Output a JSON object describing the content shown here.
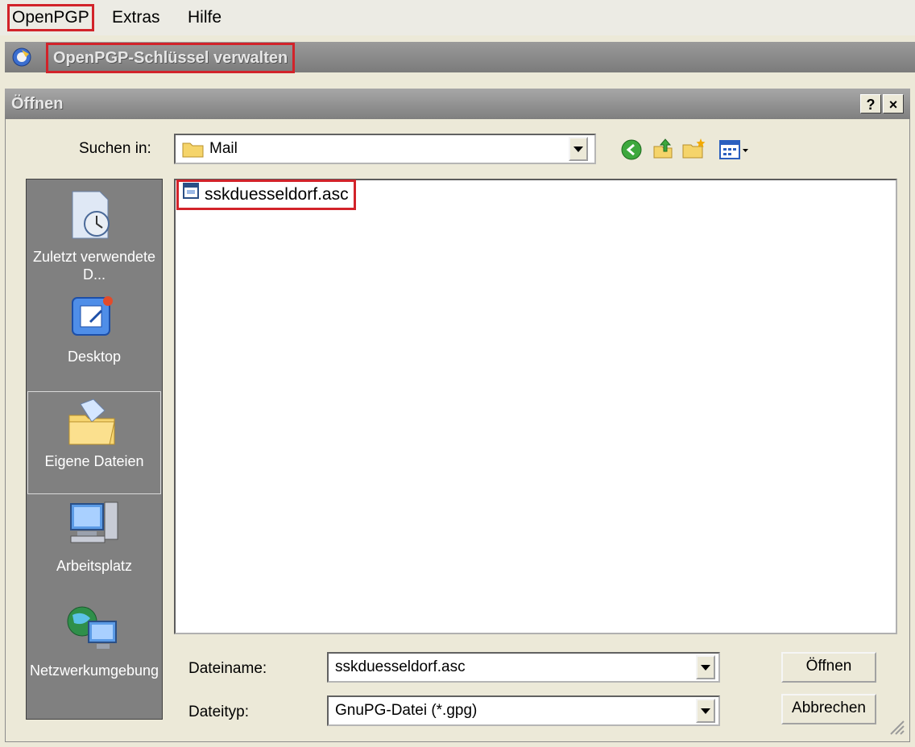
{
  "menu": {
    "openpgp": "OpenPGP",
    "extras": "Extras",
    "hilfe": "Hilfe"
  },
  "manager": {
    "title": "OpenPGP-Schlüssel verwalten"
  },
  "dialog": {
    "title": "Öffnen",
    "help_btn": "?",
    "close_btn": "×",
    "look_in_label": "Suchen in:",
    "look_in_value": "Mail",
    "places": [
      {
        "label": "Zuletzt verwendete D..."
      },
      {
        "label": "Desktop"
      },
      {
        "label": "Eigene Dateien"
      },
      {
        "label": "Arbeitsplatz"
      },
      {
        "label": "Netzwerkumgebung"
      }
    ],
    "files": [
      "sskduesseldorf.asc"
    ],
    "filename_label": "Dateiname:",
    "filename_value": "sskduesseldorf.asc",
    "filetype_label": "Dateityp:",
    "filetype_value": "GnuPG-Datei (*.gpg)",
    "open_button": "Öffnen",
    "cancel_button": "Abbrechen"
  },
  "colors": {
    "highlight": "#d2232a",
    "titlebar": "#8a8a8a",
    "places_bg": "#808080"
  }
}
